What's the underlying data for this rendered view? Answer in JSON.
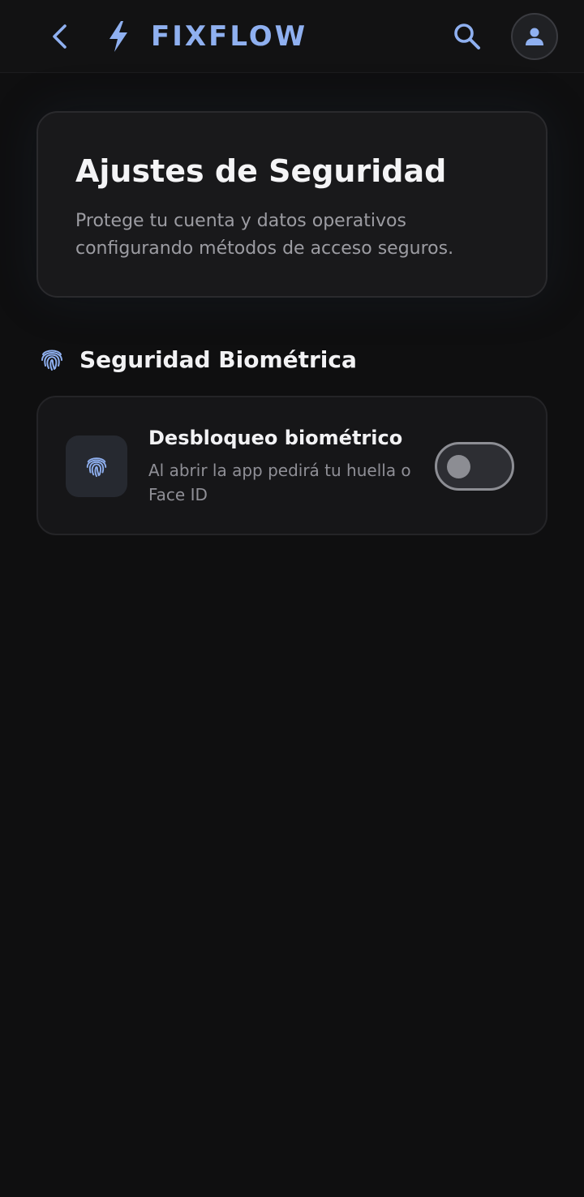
{
  "header": {
    "back_icon": "chevron-left-icon",
    "brand_icon": "bolt-icon",
    "brand_name": "FIXFLOW",
    "search_icon": "search-icon",
    "profile_icon": "person-icon",
    "accent_color": "#8fb0f0"
  },
  "hero": {
    "title": "Ajustes de Seguridad",
    "description": "Protege tu cuenta y datos operativos configurando métodos de acceso seguros."
  },
  "section": {
    "icon": "fingerprint-icon",
    "title": "Seguridad Biométrica"
  },
  "biometric_setting": {
    "icon": "fingerprint-icon",
    "title": "Desbloqueo biométrico",
    "description": "Al abrir la app pedirá tu huella o Face ID",
    "enabled": false
  }
}
